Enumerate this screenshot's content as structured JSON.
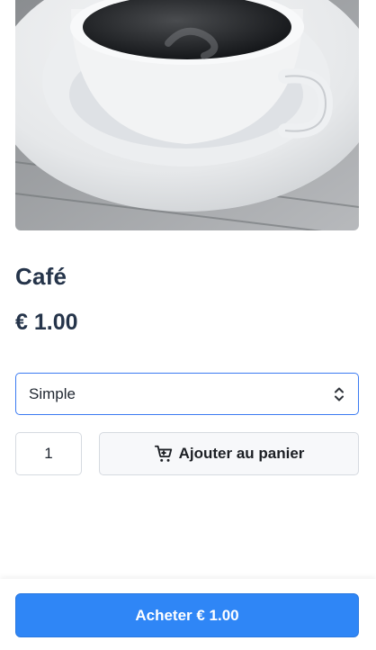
{
  "product": {
    "image_alt": "coffee-cup-photo",
    "title": "Café",
    "price": "€ 1.00"
  },
  "variant": {
    "selected": "Simple",
    "icon": "chevron-up-down-icon"
  },
  "quantity": {
    "value": "1"
  },
  "cart_button": {
    "label": "Ajouter au panier",
    "icon": "cart-icon"
  },
  "buy_button": {
    "label": "Acheter € 1.00"
  },
  "colors": {
    "heading": "#25344a",
    "accent": "#2f86f6",
    "select_border": "#3b7bf2"
  }
}
